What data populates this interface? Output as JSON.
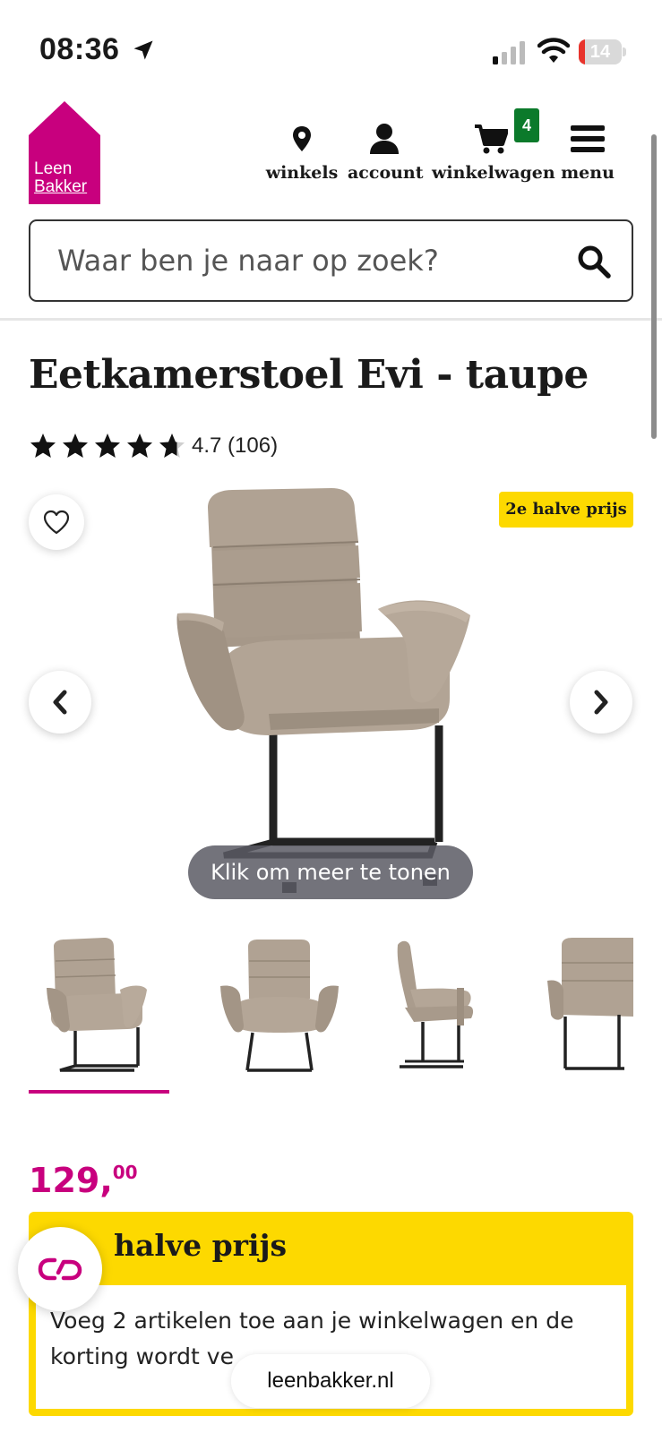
{
  "status_bar": {
    "time": "08:36",
    "battery": "14",
    "battery_level": 0.14,
    "icons": [
      "location-arrow-icon",
      "signal-icon",
      "wifi-icon",
      "battery-icon"
    ]
  },
  "header": {
    "logo": {
      "line1": "Leen",
      "line2": "Bakker",
      "color": "#c8007e"
    },
    "nav": {
      "stores": {
        "label": "winkels",
        "icon": "location-pin-icon"
      },
      "account": {
        "label": "account",
        "icon": "user-icon"
      },
      "cart": {
        "label": "winkelwagen",
        "icon": "cart-icon",
        "count": "4"
      },
      "menu": {
        "label": "menu",
        "icon": "hamburger-icon"
      }
    },
    "search": {
      "placeholder": "Waar ben je naar op zoek?",
      "value": "",
      "icon": "search-icon"
    }
  },
  "product": {
    "title": "Eetkamerstoel Evi - taupe",
    "rating": {
      "score": 4.7,
      "text": "4.7 (106)",
      "max": 5
    },
    "gallery": {
      "badge": "2e halve prijs",
      "more_label": "Klik om meer te tonen",
      "thumbnails": [
        "front-three-quarter",
        "front",
        "side",
        "back-three-quarter"
      ],
      "selected_thumbnail": 0
    },
    "price": {
      "main": "129,",
      "cents": "00"
    },
    "promo": {
      "title": "halve prijs",
      "text": "Voeg 2 artikelen toe aan je winkelwagen en de korting wordt ve"
    }
  },
  "browser": {
    "url": "leenbakker.nl"
  },
  "colors": {
    "brand": "#c8007e",
    "promo_yellow": "#fdd900",
    "cart_badge": "#0b7a2b"
  }
}
